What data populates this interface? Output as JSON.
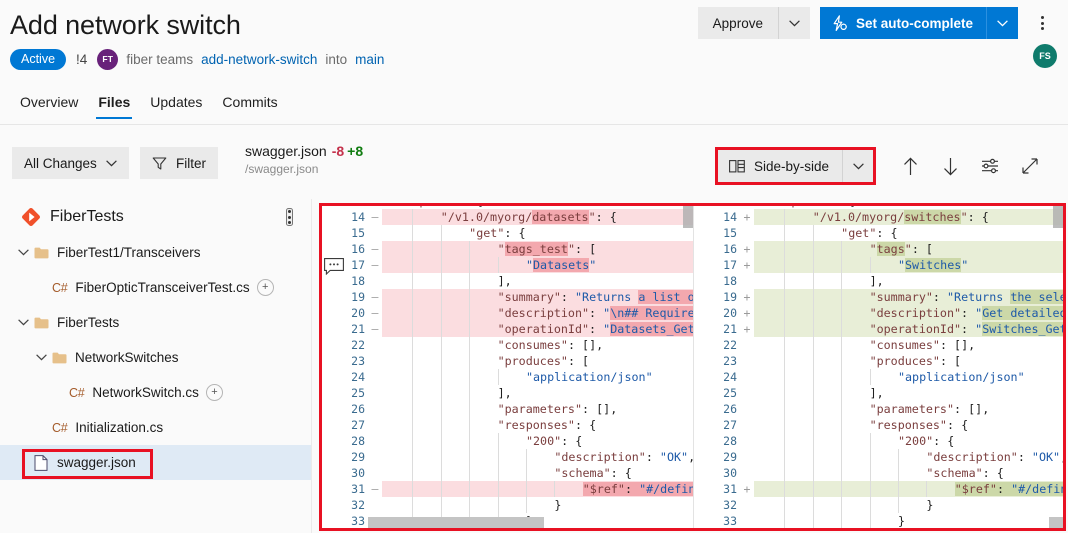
{
  "header": {
    "title": "Add network switch",
    "status_badge": "Active",
    "pr_id": "!4",
    "author_initials": "FT",
    "author": "fiber teams",
    "source_branch": "add-network-switch",
    "into_label": "into",
    "target_branch": "main",
    "reviewer_initials": "FS",
    "approve_label": "Approve",
    "autocomplete_label": "Set auto-complete",
    "more_actions_label": "More actions",
    "accent_color": "#0078d4",
    "badge_color": "#0078d4"
  },
  "tabs": [
    {
      "label": "Overview",
      "active": false
    },
    {
      "label": "Files",
      "active": true
    },
    {
      "label": "Updates",
      "active": false
    },
    {
      "label": "Commits",
      "active": false
    }
  ],
  "toolbar": {
    "all_changes_label": "All Changes",
    "filter_label": "Filter",
    "file_name": "swagger.json",
    "deletions": "-8",
    "additions": "+8",
    "file_path": "/swagger.json",
    "view_mode_label": "Side-by-side",
    "prev_diff_label": "Previous difference",
    "next_diff_label": "Next difference",
    "settings_label": "Diff settings",
    "fullscreen_label": "Full screen",
    "highlight_color": "#e81123"
  },
  "sidebar": {
    "repo_name": "FiberTests",
    "tree": [
      {
        "label": "FiberTest1/Transceivers",
        "type": "folder",
        "depth": 0,
        "expanded": true,
        "chip": ""
      },
      {
        "label": "FiberOpticTransceiverTest.cs",
        "type": "cs",
        "depth": 1,
        "expanded": false,
        "chip": "+"
      },
      {
        "label": "FiberTests",
        "type": "folder",
        "depth": 0,
        "expanded": true,
        "chip": ""
      },
      {
        "label": "NetworkSwitches",
        "type": "folder",
        "depth": 1,
        "expanded": true,
        "chip": ""
      },
      {
        "label": "NetworkSwitch.cs",
        "type": "cs",
        "depth": 2,
        "expanded": false,
        "chip": "+"
      },
      {
        "label": "Initialization.cs",
        "type": "cs",
        "depth": 1,
        "expanded": false,
        "chip": ""
      },
      {
        "label": "swagger.json",
        "type": "json",
        "depth": 1,
        "expanded": false,
        "chip": "",
        "selected": true
      }
    ]
  },
  "diff": {
    "left": {
      "rows": [
        {
          "num": "13",
          "sign": "",
          "state": "ctx",
          "indent": 1,
          "text": "\"paths\": {"
        },
        {
          "num": "14",
          "sign": "—",
          "state": "del",
          "indent": 2,
          "text": "\"/v1.0/myorg/datasets\": {"
        },
        {
          "num": "15",
          "sign": "",
          "state": "ctx",
          "indent": 3,
          "text": "\"get\": {"
        },
        {
          "num": "16",
          "sign": "—",
          "state": "del",
          "indent": 4,
          "text": "\"tags_test\": ["
        },
        {
          "num": "17",
          "sign": "—",
          "state": "del",
          "indent": 5,
          "text": "\"Datasets\""
        },
        {
          "num": "18",
          "sign": "",
          "state": "ctx",
          "indent": 4,
          "text": "],"
        },
        {
          "num": "19",
          "sign": "—",
          "state": "del",
          "indent": 4,
          "text": "\"summary\": \"Returns a list of"
        },
        {
          "num": "20",
          "sign": "—",
          "state": "del",
          "indent": 4,
          "text": "\"description\": \"\\n## Required"
        },
        {
          "num": "21",
          "sign": "—",
          "state": "del",
          "indent": 4,
          "text": "\"operationId\": \"Datasets_GetDa"
        },
        {
          "num": "22",
          "sign": "",
          "state": "ctx",
          "indent": 4,
          "text": "\"consumes\": [],"
        },
        {
          "num": "23",
          "sign": "",
          "state": "ctx",
          "indent": 4,
          "text": "\"produces\": ["
        },
        {
          "num": "24",
          "sign": "",
          "state": "ctx",
          "indent": 5,
          "text": "\"application/json\""
        },
        {
          "num": "25",
          "sign": "",
          "state": "ctx",
          "indent": 4,
          "text": "],"
        },
        {
          "num": "26",
          "sign": "",
          "state": "ctx",
          "indent": 4,
          "text": "\"parameters\": [],"
        },
        {
          "num": "27",
          "sign": "",
          "state": "ctx",
          "indent": 4,
          "text": "\"responses\": {"
        },
        {
          "num": "28",
          "sign": "",
          "state": "ctx",
          "indent": 5,
          "text": "\"200\": {"
        },
        {
          "num": "29",
          "sign": "",
          "state": "ctx",
          "indent": 6,
          "text": "\"description\": \"OK\","
        },
        {
          "num": "30",
          "sign": "",
          "state": "ctx",
          "indent": 6,
          "text": "\"schema\": {"
        },
        {
          "num": "31",
          "sign": "—",
          "state": "del",
          "indent": 7,
          "text": "\"$ref\": \"#/definit"
        },
        {
          "num": "32",
          "sign": "",
          "state": "ctx",
          "indent": 6,
          "text": "}"
        },
        {
          "num": "33",
          "sign": "",
          "state": "ctx",
          "indent": 5,
          "text": "}"
        }
      ]
    },
    "right": {
      "rows": [
        {
          "num": "13",
          "sign": "",
          "state": "ctx",
          "indent": 1,
          "text": "\"paths\": {"
        },
        {
          "num": "14",
          "sign": "+",
          "state": "add",
          "indent": 2,
          "text": "\"/v1.0/myorg/switches\": {"
        },
        {
          "num": "15",
          "sign": "",
          "state": "ctx",
          "indent": 3,
          "text": "\"get\": {"
        },
        {
          "num": "16",
          "sign": "+",
          "state": "add",
          "indent": 4,
          "text": "\"tags\": ["
        },
        {
          "num": "17",
          "sign": "+",
          "state": "add",
          "indent": 5,
          "text": "\"Switches\""
        },
        {
          "num": "18",
          "sign": "",
          "state": "ctx",
          "indent": 4,
          "text": "],"
        },
        {
          "num": "19",
          "sign": "+",
          "state": "add",
          "indent": 4,
          "text": "\"summary\": \"Returns the select"
        },
        {
          "num": "20",
          "sign": "+",
          "state": "add",
          "indent": 4,
          "text": "\"description\": \"Get detailed s"
        },
        {
          "num": "21",
          "sign": "+",
          "state": "add",
          "indent": 4,
          "text": "\"operationId\": \"Switches_GetSw"
        },
        {
          "num": "22",
          "sign": "",
          "state": "ctx",
          "indent": 4,
          "text": "\"consumes\": [],"
        },
        {
          "num": "23",
          "sign": "",
          "state": "ctx",
          "indent": 4,
          "text": "\"produces\": ["
        },
        {
          "num": "24",
          "sign": "",
          "state": "ctx",
          "indent": 5,
          "text": "\"application/json\""
        },
        {
          "num": "25",
          "sign": "",
          "state": "ctx",
          "indent": 4,
          "text": "],"
        },
        {
          "num": "26",
          "sign": "",
          "state": "ctx",
          "indent": 4,
          "text": "\"parameters\": [],"
        },
        {
          "num": "27",
          "sign": "",
          "state": "ctx",
          "indent": 4,
          "text": "\"responses\": {"
        },
        {
          "num": "28",
          "sign": "",
          "state": "ctx",
          "indent": 5,
          "text": "\"200\": {"
        },
        {
          "num": "29",
          "sign": "",
          "state": "ctx",
          "indent": 6,
          "text": "\"description\": \"OK\","
        },
        {
          "num": "30",
          "sign": "",
          "state": "ctx",
          "indent": 6,
          "text": "\"schema\": {"
        },
        {
          "num": "31",
          "sign": "+",
          "state": "add",
          "indent": 7,
          "text": "\"$ref\": \"#/definit"
        },
        {
          "num": "32",
          "sign": "",
          "state": "ctx",
          "indent": 6,
          "text": "}"
        },
        {
          "num": "33",
          "sign": "",
          "state": "ctx",
          "indent": 5,
          "text": "}"
        }
      ]
    },
    "colors": {
      "deleted_line_bg": "#fbdde0",
      "added_line_bg": "#e8eed7",
      "deleted_word_bg": "#f3a8ae",
      "added_word_bg": "#ccd8a8"
    },
    "comment_marker_line": "17"
  }
}
